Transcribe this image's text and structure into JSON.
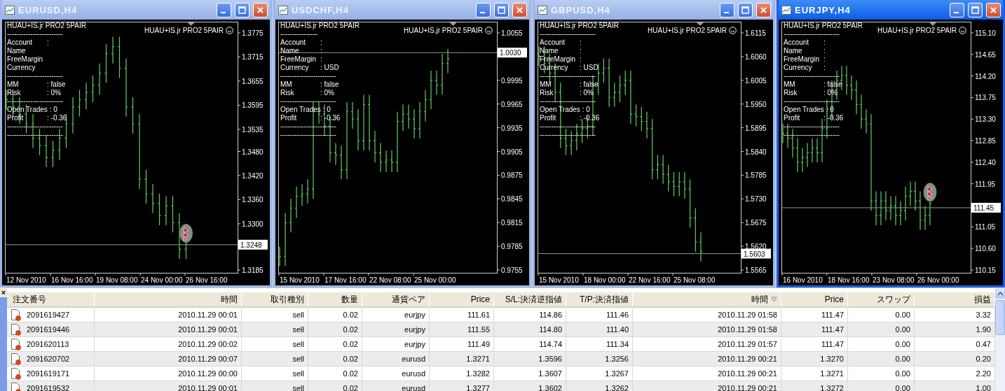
{
  "windows": [
    {
      "title": "EURUSD,H4",
      "active": false,
      "trade_marker": true,
      "indicator_label": "HUAU+IS.jr PRO2 5PAIR",
      "info_lines": [
        {
          "kind": "text",
          "text": "HUAU+IS.jr PRO2 5PAIR"
        },
        {
          "kind": "rule",
          "text": "------------------------"
        },
        {
          "kind": "field",
          "label": "Account",
          "value": ":"
        },
        {
          "kind": "field",
          "label": "Name"
        },
        {
          "kind": "field",
          "label": "FreeMargin"
        },
        {
          "kind": "field",
          "label": "Currency"
        },
        {
          "kind": "rule",
          "text": "------------------------"
        },
        {
          "kind": "field",
          "label": "MM",
          "value": ": false"
        },
        {
          "kind": "field",
          "label": "Risk",
          "value": ": 0%"
        },
        {
          "kind": "rule",
          "text": "------------------------"
        },
        {
          "kind": "field",
          "label": "Open Trades",
          "value": ": 0"
        },
        {
          "kind": "field",
          "label": "Profit",
          "value": ": -0.36"
        },
        {
          "kind": "rule",
          "text": "------------------------"
        },
        {
          "kind": "rule",
          "text": "------------------------"
        }
      ],
      "price_axis": [
        "1.3775",
        "1.3715",
        "1.3655",
        "1.3595",
        "1.3535",
        "1.3480",
        "1.3420",
        "1.3360",
        "1.3300",
        "1.3185"
      ],
      "time_axis": [
        "12 Nov 2010",
        "16 Nov 16:00",
        "19 Nov 08:00",
        "24 Nov 00:00",
        "26 Nov 16:00"
      ],
      "current_price": "1.3248"
    },
    {
      "title": "USDCHF,H4",
      "active": false,
      "trade_marker": false,
      "indicator_label": "HUAU+IS.jr PRO2 5PAIR",
      "info_lines": [
        {
          "kind": "text",
          "text": "HUAU+IS.jr PRO2 5PAIR"
        },
        {
          "kind": "rule",
          "text": "----------------"
        },
        {
          "kind": "field",
          "label": "Account",
          "value": ":"
        },
        {
          "kind": "field",
          "label": "Name",
          "value": ":"
        },
        {
          "kind": "field",
          "label": "FreeMargin",
          "value": ":"
        },
        {
          "kind": "field",
          "label": "Currency",
          "value": ": USD"
        },
        {
          "kind": "rule",
          "text": "------------------------"
        },
        {
          "kind": "field",
          "label": "MM",
          "value": ": false"
        },
        {
          "kind": "field",
          "label": "Risk",
          "value": ": 0%"
        },
        {
          "kind": "rule",
          "text": "------------------------"
        },
        {
          "kind": "field",
          "label": "Open Trades",
          "value": ": 0"
        },
        {
          "kind": "field",
          "label": "Profit",
          "value": ": -0.36"
        },
        {
          "kind": "rule",
          "text": "------------------------"
        },
        {
          "kind": "rule",
          "text": "------------------------"
        }
      ],
      "price_axis": [
        "1.0055",
        "0.9995",
        "0.9965",
        "0.9935",
        "0.9905",
        "0.9875",
        "0.9845",
        "0.9815",
        "0.9785",
        "0.9755"
      ],
      "time_axis": [
        "15 Nov 2010",
        "17 Nov 16:00",
        "22 Nov 08:00",
        "25 Nov 00:00"
      ],
      "current_price": "1.0030"
    },
    {
      "title": "GBPUSD,H4",
      "active": false,
      "trade_marker": false,
      "indicator_label": "HUAU+IS.jr PRO2 5PAIR",
      "info_lines": [
        {
          "kind": "text",
          "text": "HUAU+IS.jr PRO2 5PAIR"
        },
        {
          "kind": "rule",
          "text": "------------------------"
        },
        {
          "kind": "field",
          "label": "Account",
          "value": ":"
        },
        {
          "kind": "field",
          "label": "Name",
          "value": ":"
        },
        {
          "kind": "field",
          "label": "FreeMargin",
          "value": ":"
        },
        {
          "kind": "field",
          "label": "Currency",
          "value": ": USD"
        },
        {
          "kind": "rule",
          "text": "------------------------"
        },
        {
          "kind": "field",
          "label": "MM",
          "value": ": false"
        },
        {
          "kind": "field",
          "label": "Risk",
          "value": ": 0%"
        },
        {
          "kind": "rule",
          "text": "------------------------"
        },
        {
          "kind": "field",
          "label": "Open Trades",
          "value": ": 0"
        },
        {
          "kind": "field",
          "label": "Profit",
          "value": ": -0.36"
        },
        {
          "kind": "rule",
          "text": "------------------------"
        },
        {
          "kind": "rule",
          "text": "------------------------"
        }
      ],
      "price_axis": [
        "1.6115",
        "1.6060",
        "1.6005",
        "1.5950",
        "1.5895",
        "1.5840",
        "1.5785",
        "1.5730",
        "1.5675",
        "1.5620",
        "1.5565"
      ],
      "time_axis": [
        "15 Nov 2010",
        "18 Nov 00:00",
        "22 Nov 16:00",
        "25 Nov 08:00"
      ],
      "current_price": "1.5603"
    },
    {
      "title": "EURJPY,H4",
      "active": true,
      "trade_marker": true,
      "indicator_label": "HUAU+IS.jr PRO2 5PAIR",
      "info_lines": [
        {
          "kind": "text",
          "text": "HUAU+IS.jr PRO2 5PAIR"
        },
        {
          "kind": "rule",
          "text": "------------------------"
        },
        {
          "kind": "field",
          "label": "Account",
          "value": ":"
        },
        {
          "kind": "field",
          "label": "Name",
          "value": ":"
        },
        {
          "kind": "field",
          "label": "FreeMargin",
          "value": ":"
        },
        {
          "kind": "field",
          "label": "Currency",
          "value": ":"
        },
        {
          "kind": "rule",
          "text": "------------------------"
        },
        {
          "kind": "field",
          "label": "MM",
          "value": ": false"
        },
        {
          "kind": "field",
          "label": "Risk",
          "value": ": 0%"
        },
        {
          "kind": "rule",
          "text": "------------------------"
        },
        {
          "kind": "field",
          "label": "Open Trades",
          "value": ": 0"
        },
        {
          "kind": "field",
          "label": "Profit",
          "value": ": -0.36"
        },
        {
          "kind": "rule",
          "text": "------------------------"
        },
        {
          "kind": "rule",
          "text": "------------------------"
        }
      ],
      "price_axis": [
        "115.10",
        "114.65",
        "114.20",
        "113.75",
        "113.30",
        "112.85",
        "112.40",
        "111.95",
        "111.05",
        "110.60",
        "110.15"
      ],
      "time_axis": [
        "16 Nov 2010",
        "18 Nov 16:00",
        "23 Nov 08:00",
        "26 Nov 00:00"
      ],
      "current_price": "111.45"
    }
  ],
  "terminal": {
    "close_label": "×",
    "table": {
      "columns": [
        {
          "label": "注文番号",
          "sorted": false
        },
        {
          "label": "時間",
          "sorted": false
        },
        {
          "label": "取引種別",
          "sorted": false
        },
        {
          "label": "数量",
          "sorted": false
        },
        {
          "label": "通貨ペア",
          "sorted": false
        },
        {
          "label": "Price",
          "sorted": false
        },
        {
          "label": "S/L:決済逆指値",
          "sorted": false
        },
        {
          "label": "T/P:決済指値",
          "sorted": false
        },
        {
          "label": "時間",
          "sorted": true
        },
        {
          "label": "Price",
          "sorted": false
        },
        {
          "label": "スワップ",
          "sorted": false
        },
        {
          "label": "損益",
          "sorted": false
        }
      ],
      "rows": [
        [
          "2091619427",
          "2010.11.29 00:01",
          "sell",
          "0.02",
          "eurjpy",
          "111.61",
          "114.86",
          "111.46",
          "2010.11.29 01:58",
          "111.47",
          "0.00",
          "3.32"
        ],
        [
          "2091619446",
          "2010.11.29 00:01",
          "sell",
          "0.02",
          "eurjpy",
          "111.55",
          "114.80",
          "111.40",
          "2010.11.29 01:58",
          "111.47",
          "0.00",
          "1.90"
        ],
        [
          "2091620113",
          "2010.11.29 00:02",
          "sell",
          "0.02",
          "eurjpy",
          "111.49",
          "114.74",
          "111.34",
          "2010.11.29 01:57",
          "111.47",
          "0.00",
          "0.47"
        ],
        [
          "2091620702",
          "2010.11.29 00:07",
          "sell",
          "0.02",
          "eurusd",
          "1.3271",
          "1.3596",
          "1.3256",
          "2010.11.29 00:21",
          "1.3270",
          "0.00",
          "0.20"
        ],
        [
          "2091619171",
          "2010.11.29 00:00",
          "sell",
          "0.02",
          "eurusd",
          "1.3282",
          "1.3607",
          "1.3267",
          "2010.11.29 00:21",
          "1.3271",
          "0.00",
          "2.20"
        ],
        [
          "2091619532",
          "2010.11.29 00:01",
          "sell",
          "0.02",
          "eurusd",
          "1.3277",
          "1.3602",
          "1.3262",
          "2010.11.29 00:21",
          "1.3272",
          "0.00",
          "1.00"
        ]
      ]
    }
  }
}
